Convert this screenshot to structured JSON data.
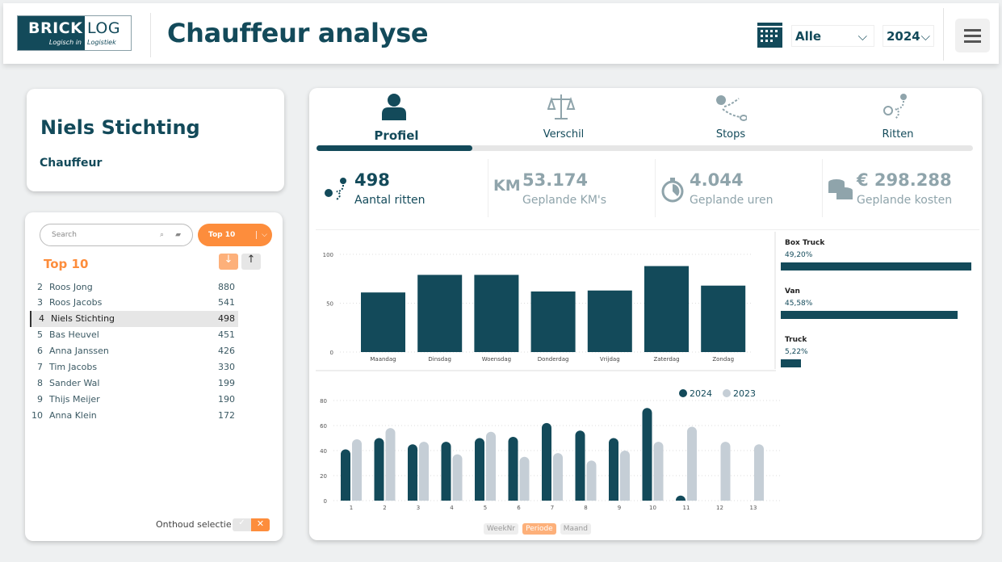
{
  "header": {
    "logo": {
      "brick": "BRICK",
      "log": "LOG",
      "tag_left": "Logisch in",
      "tag_right": "Logistiek"
    },
    "title": "Chauffeur analyse",
    "period_select": "Alle",
    "year_select": "2024",
    "icons": {
      "calendar": "calendar-icon",
      "menu": "hamburger-icon"
    }
  },
  "profile": {
    "name": "Niels Stichting",
    "role": "Chauffeur"
  },
  "ranking": {
    "search_placeholder": "Search",
    "top_select": "Top 10",
    "heading": "Top 10",
    "sort_desc": "↓",
    "sort_asc": "↑",
    "items": [
      {
        "rank": "2",
        "name": "Roos Jong",
        "value": "880"
      },
      {
        "rank": "3",
        "name": "Roos Jacobs",
        "value": "541"
      },
      {
        "rank": "4",
        "name": "Niels Stichting",
        "value": "498",
        "selected": true
      },
      {
        "rank": "5",
        "name": "Bas Heuvel",
        "value": "451"
      },
      {
        "rank": "6",
        "name": "Anna Janssen",
        "value": "426"
      },
      {
        "rank": "7",
        "name": "Tim Jacobs",
        "value": "330"
      },
      {
        "rank": "8",
        "name": "Sander Wal",
        "value": "199"
      },
      {
        "rank": "9",
        "name": "Thijs Meijer",
        "value": "190"
      },
      {
        "rank": "10",
        "name": "Anna Klein",
        "value": "172"
      }
    ],
    "remember_label": "Onthoud selectie",
    "remember_on": false
  },
  "tabs": [
    {
      "label": "Profiel",
      "icon": "person-icon",
      "active": true
    },
    {
      "label": "Verschil",
      "icon": "scale-icon"
    },
    {
      "label": "Stops",
      "icon": "route-stops-icon"
    },
    {
      "label": "Ritten",
      "icon": "route-icon"
    }
  ],
  "kpis": [
    {
      "value": "498",
      "label": "Aantal ritten",
      "icon": "route-icon"
    },
    {
      "value": "53.174",
      "label": "Geplande KM's",
      "icon_text": "KM"
    },
    {
      "value": "4.044",
      "label": "Geplande uren",
      "icon": "stopwatch-icon"
    },
    {
      "value": "€ 298.288",
      "label": "Geplande kosten",
      "icon": "coins-icon"
    }
  ],
  "colors": {
    "primary": "#134a5a",
    "secondary": "#c5ced6",
    "accent": "#fd8d3c"
  },
  "vehicles": [
    {
      "name": "Box Truck",
      "pct_label": "49,20%",
      "pct": 49.2
    },
    {
      "name": "Van",
      "pct_label": "45,58%",
      "pct": 45.58
    },
    {
      "name": "Truck",
      "pct_label": "5,22%",
      "pct": 5.22
    }
  ],
  "chart_data": [
    {
      "type": "bar",
      "categories": [
        "Maandag",
        "Dinsdag",
        "Woensdag",
        "Donderdag",
        "Vrijdag",
        "Zaterdag",
        "Zondag"
      ],
      "values": [
        61,
        79,
        79,
        62,
        63,
        88,
        68
      ],
      "ylim": [
        0,
        100
      ],
      "yticks": [
        "0",
        "50",
        "100"
      ],
      "grid": true
    },
    {
      "type": "bar",
      "categories": [
        "1",
        "2",
        "3",
        "4",
        "5",
        "6",
        "7",
        "8",
        "9",
        "10",
        "11",
        "12",
        "13"
      ],
      "series": [
        {
          "name": "2024",
          "values": [
            41,
            50,
            45,
            47,
            50,
            51,
            62,
            56,
            50,
            74,
            4,
            null,
            null
          ]
        },
        {
          "name": "2023",
          "values": [
            49,
            58,
            47,
            37,
            55,
            35,
            38,
            32,
            40,
            47,
            59,
            47,
            45
          ]
        }
      ],
      "ylim": [
        0,
        80
      ],
      "yticks": [
        "0",
        "20",
        "40",
        "60",
        "80"
      ],
      "grid": true,
      "legend": "top-right"
    }
  ],
  "granularity": {
    "options": [
      "WeekNr",
      "Periode",
      "Maand"
    ],
    "selected": "Periode"
  }
}
